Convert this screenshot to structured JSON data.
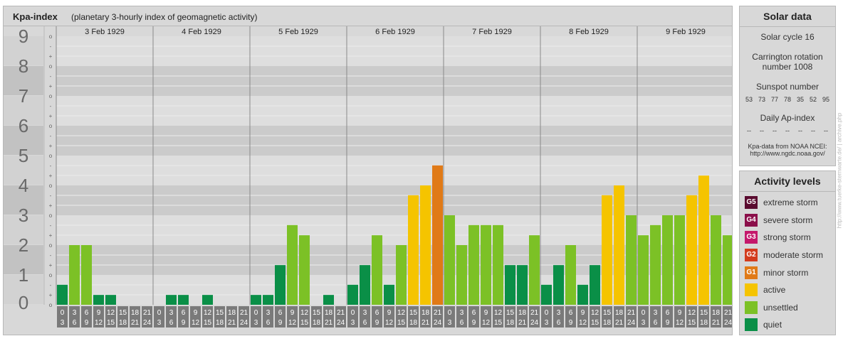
{
  "header": {
    "title": "Kpa-index",
    "subtitle": "(planetary 3-hourly index of geomagnetic activity)"
  },
  "chart_data": {
    "type": "bar",
    "title": "Kpa-index",
    "subtitle": "(planetary 3-hourly index of geomagnetic activity)",
    "ylim": [
      0,
      9
    ],
    "y_ticks": [
      "0",
      "1",
      "2",
      "3",
      "4",
      "5",
      "6",
      "7",
      "8",
      "9"
    ],
    "sub_ticks": [
      "-",
      "o",
      "+"
    ],
    "days": [
      "3 Feb 1929",
      "4 Feb 1929",
      "5 Feb 1929",
      "6 Feb 1929",
      "7 Feb 1929",
      "8 Feb 1929",
      "9 Feb 1929"
    ],
    "interval_starts": [
      "0",
      "3",
      "6",
      "9",
      "12",
      "15",
      "18",
      "21"
    ],
    "interval_ends": [
      "3",
      "6",
      "9",
      "12",
      "15",
      "18",
      "21",
      "24"
    ],
    "values": [
      0.67,
      2.0,
      2.0,
      0.33,
      0.33,
      0.0,
      0.0,
      0.0,
      0.0,
      0.33,
      0.33,
      0.0,
      0.33,
      0.0,
      0.0,
      0.0,
      0.33,
      0.33,
      1.33,
      2.67,
      2.33,
      0.0,
      0.33,
      0.0,
      0.67,
      1.33,
      2.33,
      0.67,
      2.0,
      3.67,
      4.0,
      4.67,
      3.0,
      2.0,
      2.67,
      2.67,
      2.67,
      1.33,
      1.33,
      2.33,
      0.67,
      1.33,
      2.0,
      0.67,
      1.33,
      3.67,
      4.0,
      3.0,
      2.33,
      2.67,
      3.0,
      3.0,
      3.67,
      4.33,
      3.0,
      2.33
    ],
    "levels": [
      "quiet",
      "unsettled",
      "unsettled",
      "quiet",
      "quiet",
      "quiet",
      "quiet",
      "quiet",
      "quiet",
      "quiet",
      "quiet",
      "quiet",
      "quiet",
      "quiet",
      "quiet",
      "quiet",
      "quiet",
      "quiet",
      "quiet",
      "unsettled",
      "unsettled",
      "quiet",
      "quiet",
      "quiet",
      "quiet",
      "quiet",
      "unsettled",
      "quiet",
      "unsettled",
      "active",
      "active",
      "minor",
      "unsettled",
      "unsettled",
      "unsettled",
      "unsettled",
      "unsettled",
      "quiet",
      "quiet",
      "unsettled",
      "quiet",
      "quiet",
      "unsettled",
      "quiet",
      "quiet",
      "active",
      "active",
      "unsettled",
      "unsettled",
      "unsettled",
      "unsettled",
      "unsettled",
      "active",
      "active",
      "unsettled",
      "unsettled"
    ],
    "level_colors": {
      "quiet": "#0a8f47",
      "unsettled": "#7cc126",
      "active": "#f5c400",
      "minor": "#e07a17"
    },
    "grid": true
  },
  "solar": {
    "title": "Solar data",
    "cycle": "Solar cycle 16",
    "carrington_1": "Carrington rotation",
    "carrington_2": "number 1008",
    "sunspot_title": "Sunspot number",
    "sunspots": [
      "53",
      "73",
      "77",
      "78",
      "35",
      "52",
      "95"
    ],
    "ap_title": "Daily Ap-index",
    "ap_values": [
      "--",
      "--",
      "--",
      "--",
      "--",
      "--",
      "--"
    ],
    "source_1": "Kpa-data from NOAA NCEI:",
    "source_2": "http://www.ngdc.noaa.gov/"
  },
  "activity": {
    "title": "Activity levels",
    "items": [
      {
        "code": "G5",
        "label": "extreme storm",
        "color": "#5a0b2f"
      },
      {
        "code": "G4",
        "label": "severe storm",
        "color": "#8b0f4a"
      },
      {
        "code": "G3",
        "label": "strong storm",
        "color": "#c4186b"
      },
      {
        "code": "G2",
        "label": "moderate storm",
        "color": "#d33c1e"
      },
      {
        "code": "G1",
        "label": "minor storm",
        "color": "#e07a17"
      },
      {
        "code": "",
        "label": "active",
        "color": "#f5c400"
      },
      {
        "code": "",
        "label": "unsettled",
        "color": "#7cc126"
      },
      {
        "code": "",
        "label": "quiet",
        "color": "#0a8f47"
      }
    ]
  },
  "watermark": "http://www.tuerke-sternwarte.de/ | archive.php"
}
